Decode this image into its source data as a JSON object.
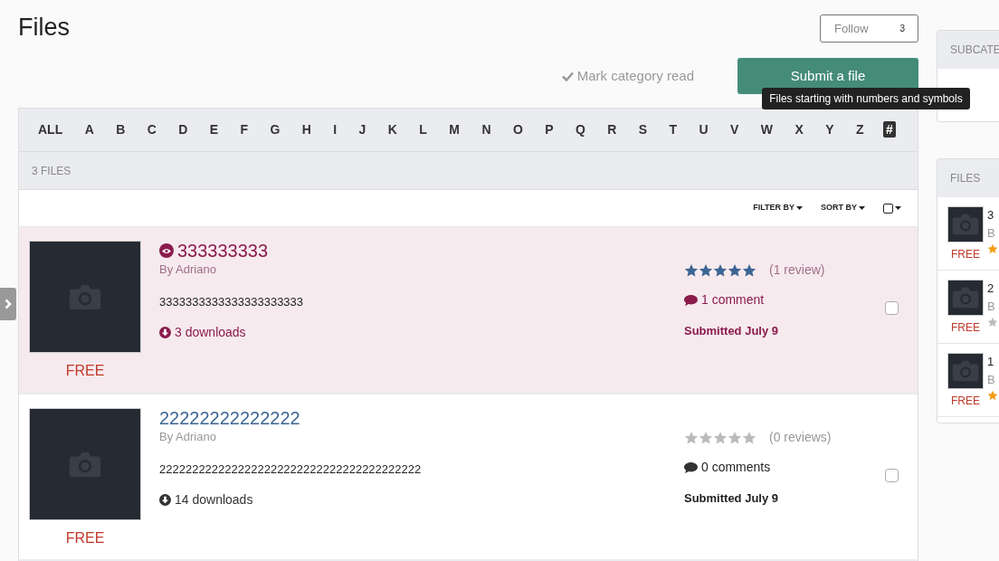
{
  "title": "Files",
  "follow": {
    "label": "Follow",
    "count": "3"
  },
  "mark_read": "Mark category read",
  "submit": "Submit a file",
  "tooltip": "Files starting with numbers and symbols",
  "letters": [
    {
      "label": "ALL",
      "selected": false
    },
    {
      "label": "A",
      "selected": false
    },
    {
      "label": "B",
      "selected": false
    },
    {
      "label": "C",
      "selected": false
    },
    {
      "label": "D",
      "selected": false
    },
    {
      "label": "E",
      "selected": false
    },
    {
      "label": "F",
      "selected": false
    },
    {
      "label": "G",
      "selected": false
    },
    {
      "label": "H",
      "selected": false
    },
    {
      "label": "I",
      "selected": false
    },
    {
      "label": "J",
      "selected": false
    },
    {
      "label": "K",
      "selected": false
    },
    {
      "label": "L",
      "selected": false
    },
    {
      "label": "M",
      "selected": false
    },
    {
      "label": "N",
      "selected": false
    },
    {
      "label": "O",
      "selected": false
    },
    {
      "label": "P",
      "selected": false
    },
    {
      "label": "Q",
      "selected": false
    },
    {
      "label": "R",
      "selected": false
    },
    {
      "label": "S",
      "selected": false
    },
    {
      "label": "T",
      "selected": false
    },
    {
      "label": "U",
      "selected": false
    },
    {
      "label": "V",
      "selected": false
    },
    {
      "label": "W",
      "selected": false
    },
    {
      "label": "X",
      "selected": false
    },
    {
      "label": "Y",
      "selected": false
    },
    {
      "label": "Z",
      "selected": false
    },
    {
      "label": "#",
      "selected": true
    }
  ],
  "count": "3 FILES",
  "filter_by": "FILTER BY",
  "sort_by": "SORT BY",
  "files": [
    {
      "title": "333333333",
      "unread": true,
      "author": "By Adriano",
      "description": "3333333333333333333333",
      "downloads": "3 downloads",
      "price": "FREE",
      "stars": 5,
      "reviews": "(1 review)",
      "comments": "1 comment",
      "submitted": "Submitted July 9",
      "checked": false
    },
    {
      "title": "22222222222222",
      "unread": false,
      "author": "By Adriano",
      "description": "2222222222222222222222222222222222222222",
      "downloads": "14 downloads",
      "price": "FREE",
      "stars": 0,
      "reviews": "(0 reviews)",
      "comments": "0 comments",
      "submitted": "Submitted July 9",
      "checked": false
    }
  ],
  "sidebar": {
    "subcategories_heading": "SUBCATE",
    "files_heading": "FILES",
    "items": [
      {
        "title": "3",
        "author": "B",
        "price": "FREE",
        "rated": true
      },
      {
        "title": "2",
        "author": "B",
        "price": "FREE",
        "rated": false
      },
      {
        "title": "1",
        "author": "B",
        "price": "FREE",
        "rated": true
      }
    ]
  }
}
